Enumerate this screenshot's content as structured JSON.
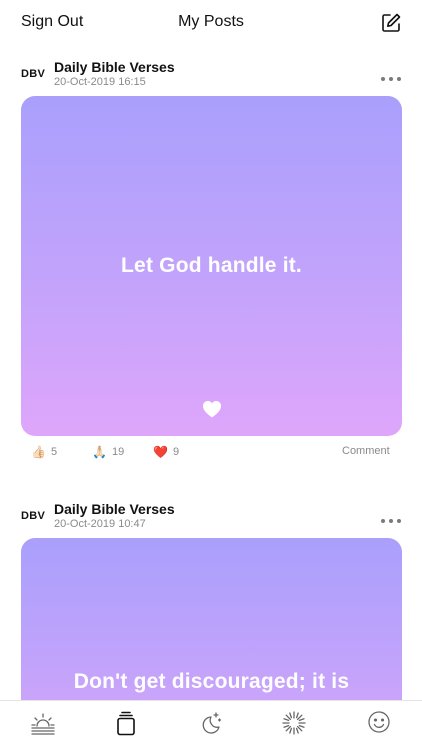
{
  "header": {
    "sign_out_label": "Sign Out",
    "title": "My Posts",
    "compose_icon": "compose-icon"
  },
  "posts": [
    {
      "avatar": "DBV",
      "author": "Daily Bible Verses",
      "date": "20-Oct-2019 16:15",
      "quote": "Let God handle it.",
      "reactions": [
        {
          "icon": "thumbs-up",
          "emoji": "👍🏻",
          "count": "5"
        },
        {
          "icon": "praying-hands",
          "emoji": "🙏🏻",
          "count": "19"
        },
        {
          "icon": "red-heart",
          "emoji": "❤️",
          "count": "9"
        }
      ],
      "comment_label": "Comment"
    },
    {
      "avatar": "DBV",
      "author": "Daily Bible Verses",
      "date": "20-Oct-2019 10:47",
      "quote": "Don't get discouraged; it is"
    }
  ],
  "colors": {
    "card_gradient_top": "#a9a0fc",
    "card_gradient_bottom": "#dea6fb",
    "muted_text": "#8a8a8a"
  },
  "tabbar": {
    "tabs": [
      {
        "icon": "sunrise-icon",
        "active": false
      },
      {
        "icon": "posts-stack-icon",
        "active": true
      },
      {
        "icon": "moon-stars-icon",
        "active": false
      },
      {
        "icon": "sunburst-icon",
        "active": false
      },
      {
        "icon": "smiley-icon",
        "active": false
      }
    ]
  }
}
